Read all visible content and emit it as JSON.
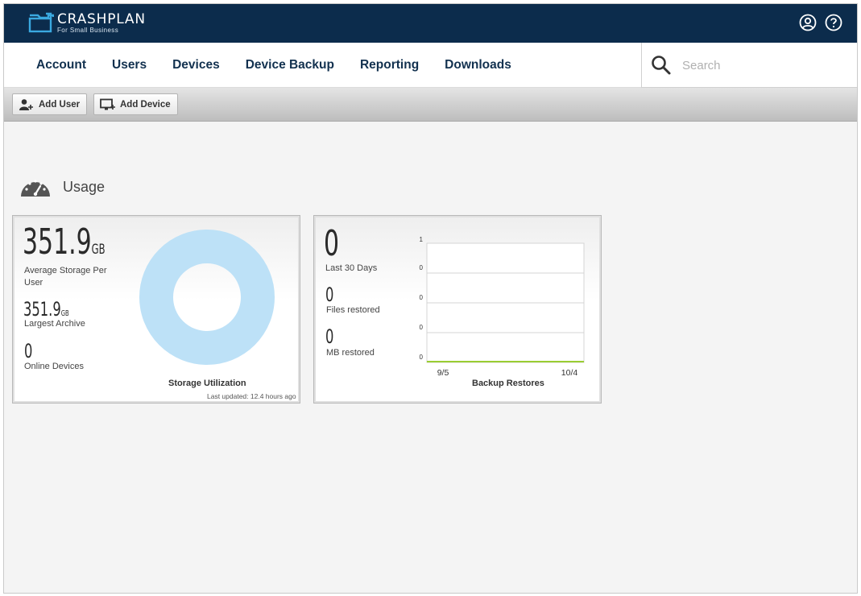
{
  "app": {
    "logo_name": "CRASHPLAN",
    "logo_tagline": "For Small Business",
    "account_icon": "user-circle-icon",
    "help_icon": "question-circle-icon"
  },
  "nav": {
    "items": [
      "Account",
      "Users",
      "Devices",
      "Device Backup",
      "Reporting",
      "Downloads"
    ],
    "search_placeholder": "Search"
  },
  "toolbar": {
    "add_user": "Add User",
    "add_device": "Add Device"
  },
  "section": {
    "title": "Usage"
  },
  "storage_card": {
    "avg_value": "351.9",
    "avg_unit": "GB",
    "avg_label": "Average Storage Per User",
    "largest_value": "351.9",
    "largest_unit": "GB",
    "largest_label": "Largest Archive",
    "online_value": "0",
    "online_label": "Online Devices",
    "chart_title": "Storage Utilization",
    "last_updated": "Last updated: 12.4 hours ago",
    "donut_color": "#bde1f7"
  },
  "restores_card": {
    "last30_value": "0",
    "last30_label": "Last 30 Days",
    "files_value": "0",
    "files_label": "Files restored",
    "mb_value": "0",
    "mb_label": "MB restored",
    "chart_title": "Backup Restores"
  },
  "chart_data": {
    "type": "line",
    "title": "Backup Restores",
    "x_tick_labels": [
      "9/5",
      "10/4"
    ],
    "y_tick_labels": [
      "1",
      "0",
      "0",
      "0",
      "0"
    ],
    "ylim": [
      0,
      1
    ],
    "grid": true,
    "series": [
      {
        "values": [
          0,
          0
        ],
        "color": "#9acd32"
      }
    ]
  },
  "colors": {
    "topbar": "#0c2c4c",
    "nav_text": "#12314f",
    "logo_accent": "#3aa9e0"
  }
}
